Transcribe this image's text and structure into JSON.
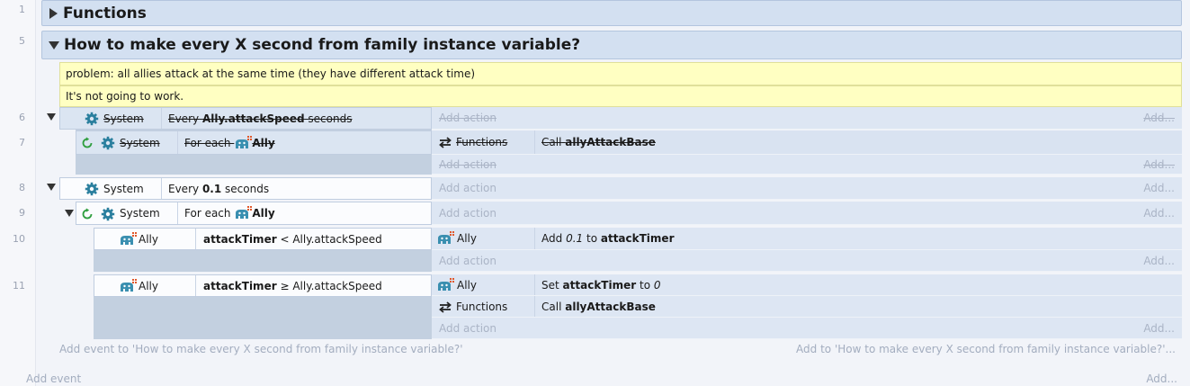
{
  "line_numbers": [
    "1",
    "5",
    "6",
    "7",
    "8",
    "9",
    "10",
    "11"
  ],
  "groups": {
    "functions": "Functions",
    "question": "How to make every X second from family instance variable?"
  },
  "comments": {
    "c1": "problem: all allies attack at the same time (they have different attack time)",
    "c2": "It's not going to work."
  },
  "objects": {
    "system": "System",
    "ally": "Ally",
    "functions": "Functions"
  },
  "conditions": {
    "every_pre": "Every",
    "every_var": "Ally.attackSpeed",
    "every_post": "seconds",
    "for_each": "For each",
    "every_value": "0.1",
    "cmp_var": "attackTimer",
    "cmp_lt": "<",
    "cmp_ge": "≥",
    "cmp_rhs": "Ally.attackSpeed"
  },
  "actions": {
    "call": "Call",
    "ally_attack_base": "allyAttackBase",
    "add": "Add",
    "add_value": "0.1",
    "to": "to",
    "set": "Set",
    "attack_timer": "attackTimer",
    "set_value": "0"
  },
  "placeholders": {
    "add_action": "Add action",
    "add_more": "Add...",
    "add_event_group": "Add event to 'How to make every X second from family instance variable?'",
    "add_to_group": "Add to 'How to make every X second from family instance variable?'...",
    "add_event": "Add event",
    "add_bottom": "Add..."
  },
  "colors": {
    "group_bg": "#d3e0f1",
    "comment_bg": "#ffffc2",
    "event_bg": "#dbe5f2",
    "icon_teal": "#2a7f9e",
    "loop_green": "#2e9e3e",
    "ally_dots": "#e0582b"
  }
}
